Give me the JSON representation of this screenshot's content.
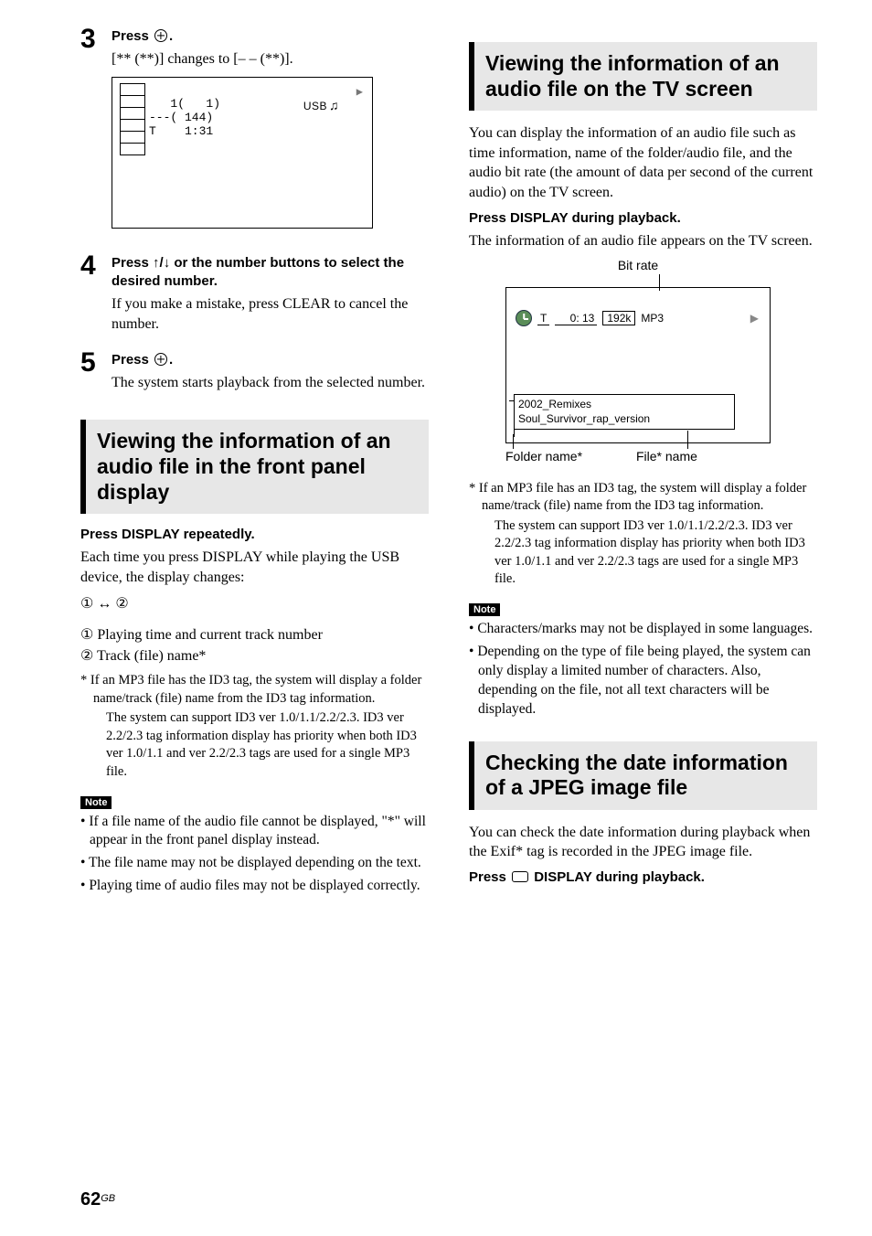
{
  "left": {
    "step3": {
      "title_prefix": "Press ",
      "title_suffix": ".",
      "line": "[** (**)] changes to [– – (**)].",
      "diagram": {
        "line1": "   1(   1)",
        "line2": "---( 144)",
        "line3": "T    1:31",
        "usb_label": "USB",
        "play_icon": "▶"
      }
    },
    "step4": {
      "title": "Press ↑/↓ or the number buttons to select the desired number.",
      "text": "If you make a mistake, press CLEAR to cancel the number."
    },
    "step5": {
      "title_prefix": "Press ",
      "title_suffix": ".",
      "text": "The system starts playback from the selected number."
    },
    "section1_title": "Viewing the information of an audio file in the front panel display",
    "press_display_repeatedly": "Press DISPLAY repeatedly.",
    "each_time": "Each time you press DISPLAY while playing the USB device, the display changes:",
    "toggle_row": "① ↔ ②",
    "defs": {
      "d1": "① Playing time and current track number",
      "d2": "② Track (file) name*"
    },
    "footnote_lead": "* If an MP3 file has the ID3 tag, the system will display a folder name/track (file) name from the ID3 tag information.",
    "footnote_body": "The system can support ID3 ver 1.0/1.1/2.2/2.3. ID3 ver 2.2/2.3 tag information display has priority when both ID3 ver 1.0/1.1 and ver 2.2/2.3 tags are used for a single MP3 file.",
    "note_label": "Note",
    "notes": [
      "If a file name of the audio file cannot be displayed, \"*\" will appear in the front panel display instead.",
      "The file name may not be displayed depending on the text.",
      "Playing time of audio files may not be displayed correctly."
    ]
  },
  "right": {
    "section2_title": "Viewing the information of an audio file on the TV screen",
    "intro": "You can display the information of an audio file such as time information, name of the folder/audio file, and the audio bit rate (the amount of data per second of the current audio) on the TV screen.",
    "press_display_during": "Press DISPLAY during playback.",
    "info_line": "The information of an audio file appears on the TV screen.",
    "tv": {
      "bit_rate_label": "Bit rate",
      "t_label": "T",
      "time": "0: 13",
      "bitrate": "192k",
      "codec": "MP3",
      "play_icon": "▶",
      "folder_line1": "2002_Remixes",
      "folder_line2": "Soul_Survivor_rap_version",
      "folder_caption": "Folder name*",
      "file_caption": "File* name"
    },
    "footnote_lead": "* If an MP3 file has an ID3 tag, the system will display a folder name/track (file) name from the ID3 tag information.",
    "footnote_body": "The system can support ID3 ver 1.0/1.1/2.2/2.3. ID3 ver 2.2/2.3 tag information display has priority when both ID3 ver 1.0/1.1 and ver 2.2/2.3 tags are used for a single MP3 file.",
    "note_label": "Note",
    "notes": [
      "Characters/marks may not be displayed in some languages.",
      "Depending on the type of file being played, the system can only display a limited number of characters. Also, depending on the file, not all text characters will be displayed."
    ],
    "section3_title": "Checking the date information of a JPEG image file",
    "jpeg_intro": "You can check the date information during playback when the Exif* tag is recorded in the JPEG image file.",
    "press_display_btn_prefix": "Press ",
    "press_display_btn_suffix": " DISPLAY during playback."
  },
  "footer": {
    "page": "62",
    "region": "GB"
  }
}
